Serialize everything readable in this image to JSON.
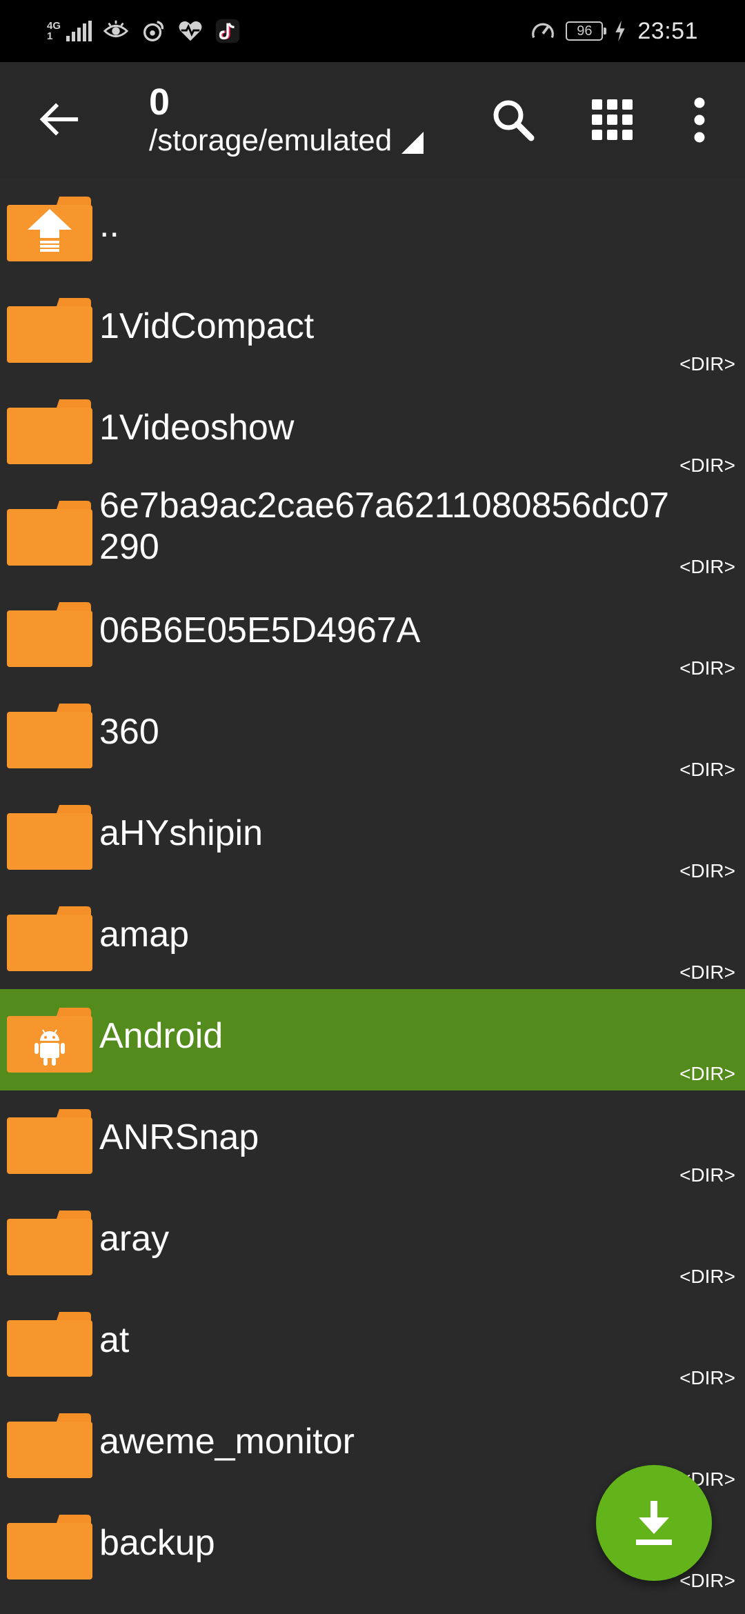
{
  "status_bar": {
    "network_type_top": "4G",
    "network_type_bottom": "1",
    "battery_level": "96",
    "clock": "23:51",
    "icons": [
      "signal-icon",
      "eye-icon",
      "weibo-icon",
      "health-icon",
      "tiktok-icon",
      "speed-icon",
      "battery-icon",
      "charging-icon"
    ]
  },
  "toolbar": {
    "title_count": "0",
    "path": "/storage/emulated",
    "icons": [
      "back-arrow-icon",
      "search-icon",
      "grid-view-icon",
      "more-vert-icon"
    ]
  },
  "files": [
    {
      "name": "..",
      "tag": "",
      "icon": "folder-up-icon",
      "selected": false
    },
    {
      "name": "1VidCompact",
      "tag": "<DIR>",
      "icon": "folder-icon",
      "selected": false
    },
    {
      "name": "1Videoshow",
      "tag": "<DIR>",
      "icon": "folder-icon",
      "selected": false
    },
    {
      "name": "6e7ba9ac2cae67a6211080856dc07290",
      "tag": "<DIR>",
      "icon": "folder-icon",
      "selected": false
    },
    {
      "name": "06B6E05E5D4967A",
      "tag": "<DIR>",
      "icon": "folder-icon",
      "selected": false
    },
    {
      "name": "360",
      "tag": "<DIR>",
      "icon": "folder-icon",
      "selected": false
    },
    {
      "name": "aHYshipin",
      "tag": "<DIR>",
      "icon": "folder-icon",
      "selected": false
    },
    {
      "name": "amap",
      "tag": "<DIR>",
      "icon": "folder-icon",
      "selected": false
    },
    {
      "name": "Android",
      "tag": "<DIR>",
      "icon": "folder-android-icon",
      "selected": true
    },
    {
      "name": "ANRSnap",
      "tag": "<DIR>",
      "icon": "folder-icon",
      "selected": false
    },
    {
      "name": "aray",
      "tag": "<DIR>",
      "icon": "folder-icon",
      "selected": false
    },
    {
      "name": "at",
      "tag": "<DIR>",
      "icon": "folder-icon",
      "selected": false
    },
    {
      "name": "aweme_monitor",
      "tag": "<DIR>",
      "icon": "folder-icon",
      "selected": false
    },
    {
      "name": "backup",
      "tag": "<DIR>",
      "icon": "folder-icon",
      "selected": false
    }
  ],
  "fab": {
    "icon": "download-icon"
  },
  "colors": {
    "folder": "#f7962c",
    "folder_tab": "#f59028",
    "selected_row": "#548b1d",
    "fab": "#63b41a",
    "background": "#2a2a2a",
    "toolbar": "#282828"
  }
}
